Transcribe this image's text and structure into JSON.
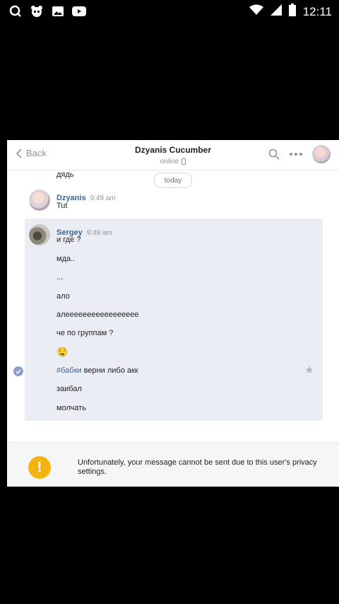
{
  "status_bar": {
    "time": "12:11"
  },
  "header": {
    "back_label": "Back",
    "title": "Dzyanis Cucumber",
    "subtitle": "online"
  },
  "date_separator": "today",
  "cut_off_text": "дядь",
  "messages": [
    {
      "author": "Dzyanis",
      "time": "9:49 am",
      "text": "Tut"
    }
  ],
  "selected_group": {
    "author": "Sergey",
    "time": "9:49 am",
    "lines": [
      "и где ?",
      "мда..",
      "...",
      "ало",
      "алеееееееееееееееее",
      "че по группам ?",
      "🤤",
      "верни либо акк",
      "заибал",
      "молчать"
    ],
    "hashtag": "#бабки"
  },
  "notice": {
    "text": "Unfortunately, your message cannot be sent due to this user's privacy settings."
  },
  "colors": {
    "accent": "#3f6694",
    "warning": "#f5b30f",
    "selection_bg": "#ebedf4"
  }
}
